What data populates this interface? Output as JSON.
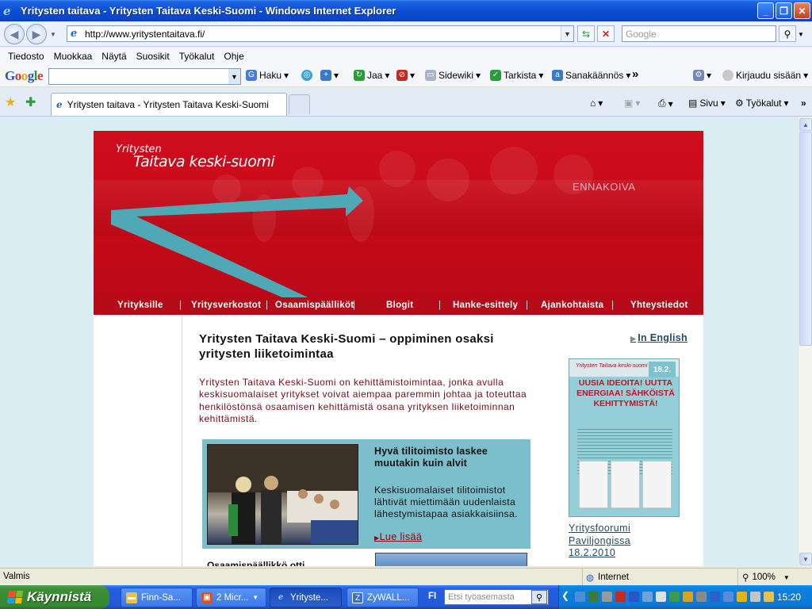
{
  "window": {
    "title": "Yritysten taitava - Yritysten Taitava Keski-Suomi - Windows Internet Explorer",
    "min": "_",
    "max": "❐",
    "close": "✕"
  },
  "address": {
    "url": "http://www.yritystentaitava.fi/",
    "search_placeholder": "Google"
  },
  "menu": [
    "Tiedosto",
    "Muokkaa",
    "Näytä",
    "Suosikit",
    "Työkalut",
    "Ohje"
  ],
  "google_toolbar": {
    "items": [
      "Haku",
      "Jaa",
      "Sidewiki",
      "Tarkista",
      "Sanakäännös",
      "»",
      "Kirjaudu sisään"
    ]
  },
  "tab": {
    "title": "Yritysten taitava - Yritysten Taitava Keski-Suomi"
  },
  "commands": {
    "page": "Sivu",
    "tools": "Työkalut"
  },
  "site": {
    "logo_line1": "Yritysten",
    "logo_line2": "Taitava keski-suomi",
    "slogan": "ENNAKOIVA",
    "nav": [
      "Yrityksille",
      "Yritysverkostot",
      "Osaamispäälliköt",
      "Blogit",
      "Hanke-esittely",
      "Ajankohtaista",
      "Yhteystiedot"
    ],
    "heading": "Yritysten Taitava Keski-Suomi – oppiminen osaksi yritysten liiketoimintaa",
    "intro": "Yritysten Taitava Keski-Suomi on kehittämistoimintaa, jonka avulla keskisuomalaiset yritykset voivat aiempaa paremmin johtaa ja toteuttaa henkilöstönsä osaamisen kehittämistä osana yrityksen liiketoiminnan kehittämistä.",
    "feature": {
      "title": "Hyvä tilitoimisto laskee muutakin kuin alvit",
      "body": "Keskisuomalaiset tilitoimistot lähtivät miettimään uudenlaista lähestymistapaa asiakkaisiinsa.",
      "more": "Lue lisää"
    },
    "teaser": "Osaamispäällikkö otti",
    "english": "In English",
    "poster": {
      "logo": "Yritysten Taitava keski-suomi",
      "date": "18.2.",
      "headline": "UUSIA IDEOITA! UUTTA ENERGIAA! SÄHKÖISTÄ KEHITTYMISTÄ!",
      "caption": "Yritysfoorumi Paviljongissa 18.2.2010"
    }
  },
  "status": {
    "left": "Valmis",
    "zone": "Internet",
    "zoom": "100%"
  },
  "taskbar": {
    "start": "Käynnistä",
    "buttons": [
      "Finn-Sa...",
      "2 Micr...",
      "Yrityste...",
      "ZyWALL..."
    ],
    "lang": "FI",
    "search_placeholder": "Etsi työasemasta",
    "clock": "15:20"
  },
  "colors": {
    "banner_red": "#c30a17",
    "feature_bg": "#7cbfcc",
    "link_blue": "#244a66"
  }
}
